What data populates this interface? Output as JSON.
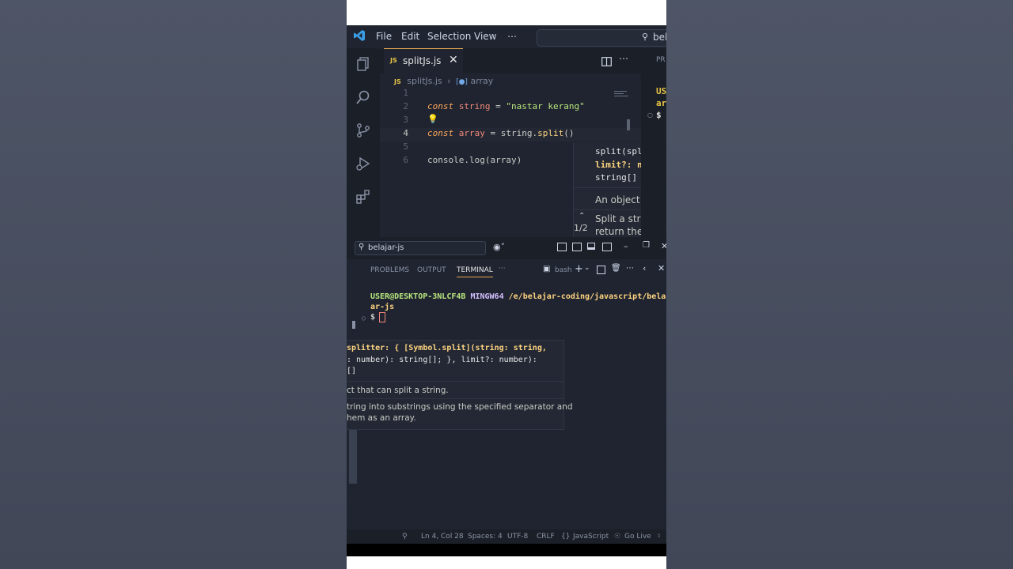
{
  "titlebar": {
    "menu": [
      "File",
      "Edit",
      "Selection",
      "View",
      "⋯"
    ],
    "search_text": "belaj"
  },
  "editor": {
    "tab": {
      "label": "splitJs.js",
      "icon": "JS"
    },
    "breadcrumbs": {
      "file": "splitJs.js",
      "symbol": "array"
    },
    "lines": [
      {
        "n": "1",
        "text": ""
      },
      {
        "n": "2",
        "text": "const string = \"nastar kerang\""
      },
      {
        "n": "3",
        "text": ""
      },
      {
        "n": "4",
        "text": "const array = string.split()"
      },
      {
        "n": "5",
        "text": ""
      },
      {
        "n": "6",
        "text": "console.log(array)"
      }
    ],
    "hover": {
      "sig1": "split(splitter",
      "sig2": "limit?: number",
      "ret": "string[]",
      "doc1": "An object that ca",
      "doc2": "Split a string into",
      "doc3": "return them as ar",
      "counter": "1/2"
    }
  },
  "right_peek": {
    "line1": "US",
    "line2": "ar",
    "line3": "$",
    "header": "PR"
  },
  "panel": {
    "search": "belajar-js",
    "tabs": [
      "PROBLEMS",
      "OUTPUT",
      "TERMINAL",
      "···"
    ],
    "shell": "bash"
  },
  "terminal": {
    "prompt_user": "USER@DESKTOP-3NLCF4B",
    "prompt_env": "MINGW64",
    "prompt_path1": "/e/belajar-coding/javascript/belaj",
    "prompt_path2": "ar-js",
    "dollar": "$"
  },
  "hover_big": {
    "sig_line1": "splitter: { [Symbol.split](string: string,",
    "sig_line2": ": number): string[]; }, limit?: number):",
    "sig_line3": "[]",
    "doc1": "ct that can split a string.",
    "doc2": "tring into substrings using the specified separator and",
    "doc3": "hem as an array."
  },
  "status": {
    "position": "Ln 4, Col 28",
    "spaces": "Spaces: 4",
    "encoding": "UTF-8",
    "eol": "CRLF",
    "language": "JavaScript",
    "golive": "Go Live"
  },
  "colors": {
    "accent": "#e0a44c",
    "bg": "#1f2430"
  }
}
